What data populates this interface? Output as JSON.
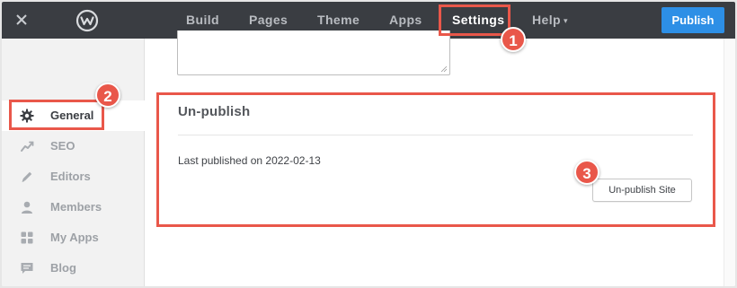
{
  "topbar": {
    "nav": [
      {
        "label": "Build"
      },
      {
        "label": "Pages"
      },
      {
        "label": "Theme"
      },
      {
        "label": "Apps"
      },
      {
        "label": "Settings"
      },
      {
        "label": "Help"
      }
    ],
    "help_caret": "▾",
    "publish_label": "Publish",
    "colors": {
      "bar": "#3a3d42",
      "publish": "#2d8fe6"
    }
  },
  "sidebar": {
    "items": [
      {
        "label": "General",
        "icon": "gear-icon"
      },
      {
        "label": "SEO",
        "icon": "trend-icon"
      },
      {
        "label": "Editors",
        "icon": "pencil-icon"
      },
      {
        "label": "Members",
        "icon": "user-icon"
      },
      {
        "label": "My Apps",
        "icon": "grid-icon"
      },
      {
        "label": "Blog",
        "icon": "comment-icon"
      }
    ]
  },
  "main": {
    "section_title": "Un-publish",
    "last_published": "Last published on 2022-02-13",
    "unpublish_button": "Un-publish Site"
  },
  "annotations": {
    "badges": [
      "1",
      "2",
      "3"
    ],
    "color": "#e9574a"
  }
}
